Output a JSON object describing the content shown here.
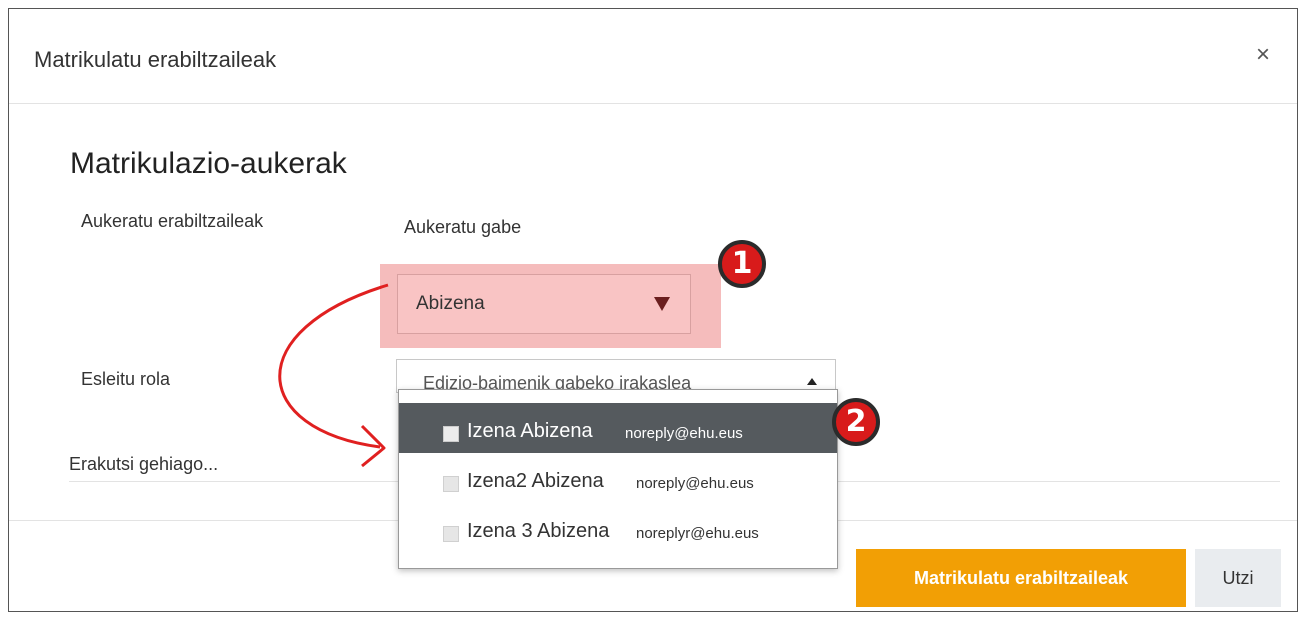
{
  "modal": {
    "title": "Matrikulatu erabiltzaileak",
    "close_label": "×"
  },
  "section": {
    "heading": "Matrikulazio-aukerak"
  },
  "select_users": {
    "label": "Aukeratu erabiltzaileak",
    "status": "Aukeratu gabe",
    "search_value": "Abizena"
  },
  "role": {
    "label": "Esleitu rola",
    "value": "Edizio-baimenik gabeko irakaslea"
  },
  "dropdown": {
    "items": [
      {
        "name": "Izena Abizena",
        "email": "noreply@ehu.eus"
      },
      {
        "name": "Izena2 Abizena",
        "email": "noreply@ehu.eus"
      },
      {
        "name": "Izena 3 Abizena",
        "email": "noreplyr@ehu.eus"
      }
    ]
  },
  "show_more": "Erakutsi gehiago...",
  "annotations": {
    "badge_1": "1",
    "badge_2": "2",
    "highlight_color": "#f5bcbc",
    "badge_color": "#d81b1b",
    "arrow_color": "#e02020"
  },
  "footer": {
    "enrol_button": "Matrikulatu erabiltzaileak",
    "cancel_button": "Utzi",
    "primary_color": "#f29f05"
  }
}
